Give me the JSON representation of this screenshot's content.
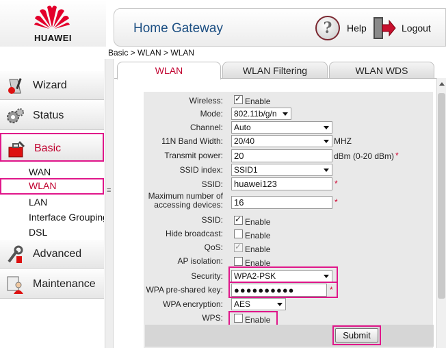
{
  "brand": {
    "name": "HUAWEI",
    "accent": "#e0168a",
    "logo_red": "#e3002b"
  },
  "header": {
    "title": "Home Gateway",
    "help_label": "Help",
    "logout_label": "Logout"
  },
  "breadcrumb": "Basic > WLAN > WLAN",
  "sidebar": {
    "items": [
      {
        "label": "Wizard",
        "icon": "wizard-icon",
        "active": false
      },
      {
        "label": "Status",
        "icon": "status-gears-icon",
        "active": false
      },
      {
        "label": "Basic",
        "icon": "basic-toolbox-icon",
        "active": true
      },
      {
        "label": "Advanced",
        "icon": "advanced-tools-icon",
        "active": false
      },
      {
        "label": "Maintenance",
        "icon": "maintenance-user-icon",
        "active": false
      }
    ],
    "basic_subitems": [
      {
        "label": "WAN",
        "active": false
      },
      {
        "label": "WLAN",
        "active": true
      },
      {
        "label": "LAN",
        "active": false
      },
      {
        "label": "Interface Grouping",
        "active": false
      },
      {
        "label": "DSL",
        "active": false
      }
    ]
  },
  "tabs": [
    {
      "label": "WLAN",
      "active": true
    },
    {
      "label": "WLAN Filtering",
      "active": false
    },
    {
      "label": "WLAN WDS",
      "active": false
    }
  ],
  "form": {
    "wireless": {
      "label": "Wireless:",
      "checked": true,
      "option": "Enable"
    },
    "mode": {
      "label": "Mode:",
      "value": "802.11b/g/n"
    },
    "channel": {
      "label": "Channel:",
      "value": "Auto"
    },
    "band_width": {
      "label": "11N Band Width:",
      "value": "20/40",
      "unit": "MHZ"
    },
    "transmit_power": {
      "label": "Transmit power:",
      "value": "20",
      "unit": "dBm (0-20 dBm)",
      "required": "*"
    },
    "ssid_index": {
      "label": "SSID index:",
      "value": "SSID1"
    },
    "ssid": {
      "label": "SSID:",
      "value": "huawei123",
      "required": "*"
    },
    "max_devices": {
      "label_line1": "Maximum number of",
      "label_line2": "accessing devices:",
      "value": "16",
      "required": "*"
    },
    "ssid_enable": {
      "label": "SSID:",
      "checked": true,
      "option": "Enable"
    },
    "hide_broadcast": {
      "label": "Hide broadcast:",
      "checked": false,
      "option": "Enable"
    },
    "qos": {
      "label": "QoS:",
      "checked": true,
      "disabled": true,
      "option": "Enable"
    },
    "ap_isolation": {
      "label": "AP isolation:",
      "checked": false,
      "option": "Enable"
    },
    "security": {
      "label": "Security:",
      "value": "WPA2-PSK"
    },
    "wpa_key": {
      "label": "WPA pre-shared key:",
      "value": "●●●●●●●●●●",
      "required": "*"
    },
    "wpa_encryption": {
      "label": "WPA encryption:",
      "value": "AES"
    },
    "wps": {
      "label": "WPS:",
      "checked": false,
      "option": "Enable"
    },
    "submit_label": "Submit"
  }
}
